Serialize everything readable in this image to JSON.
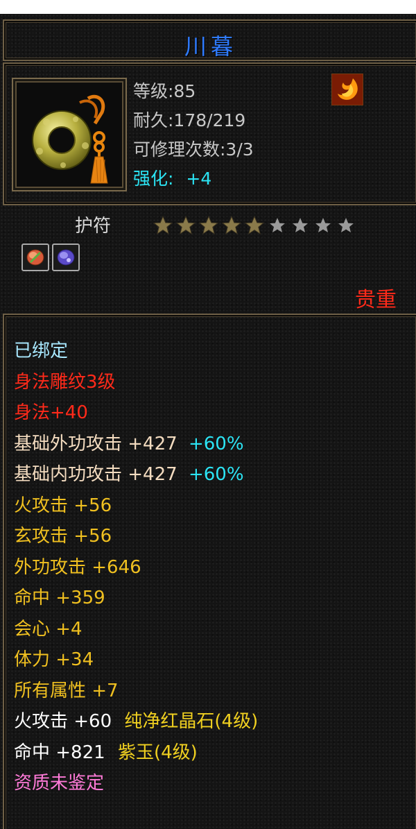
{
  "item": {
    "name": "川暮",
    "type": "护符",
    "rarity": "贵重",
    "level_label": "等级:85",
    "durability_label": "耐久:178/219",
    "repair_label": "可修理次数:3/3",
    "enhance_label": "强化:",
    "enhance_value": "+4",
    "stars": {
      "lit": 5,
      "total": 9
    },
    "sockets": [
      "red-gem-icon",
      "purple-gem-icon"
    ],
    "corner_icon": "fire-gem-icon",
    "item_icon": "jade-ring-amulet-icon"
  },
  "colors": {
    "title": "#2f7bff",
    "bound": "#a8e8ff",
    "red": "#ff2a1a",
    "gold": "#f0c020",
    "cyan": "#2be4f4",
    "white": "#ffffff",
    "pink": "#ff7ad8"
  },
  "props": {
    "bound": "已绑定",
    "engrave": "身法雕纹3级",
    "agility": "身法+40",
    "ext_atk": {
      "text": "基础外功攻击 +427",
      "bonus": "+60%"
    },
    "int_atk": {
      "text": "基础内功攻击 +427",
      "bonus": "+60%"
    },
    "fire_atk": "火攻击 +56",
    "xuan_atk": "玄攻击 +56",
    "outer_atk": "外功攻击 +646",
    "hit": "命中 +359",
    "crit": "会心 +4",
    "stamina": "体力 +34",
    "all_attr": "所有属性 +7",
    "gem1": {
      "stat": "火攻击 +60",
      "name": "纯净红晶石(4级)"
    },
    "gem2": {
      "stat": "命中 +821",
      "name": "紫玉(4级)"
    },
    "aptitude": "资质未鉴定"
  }
}
